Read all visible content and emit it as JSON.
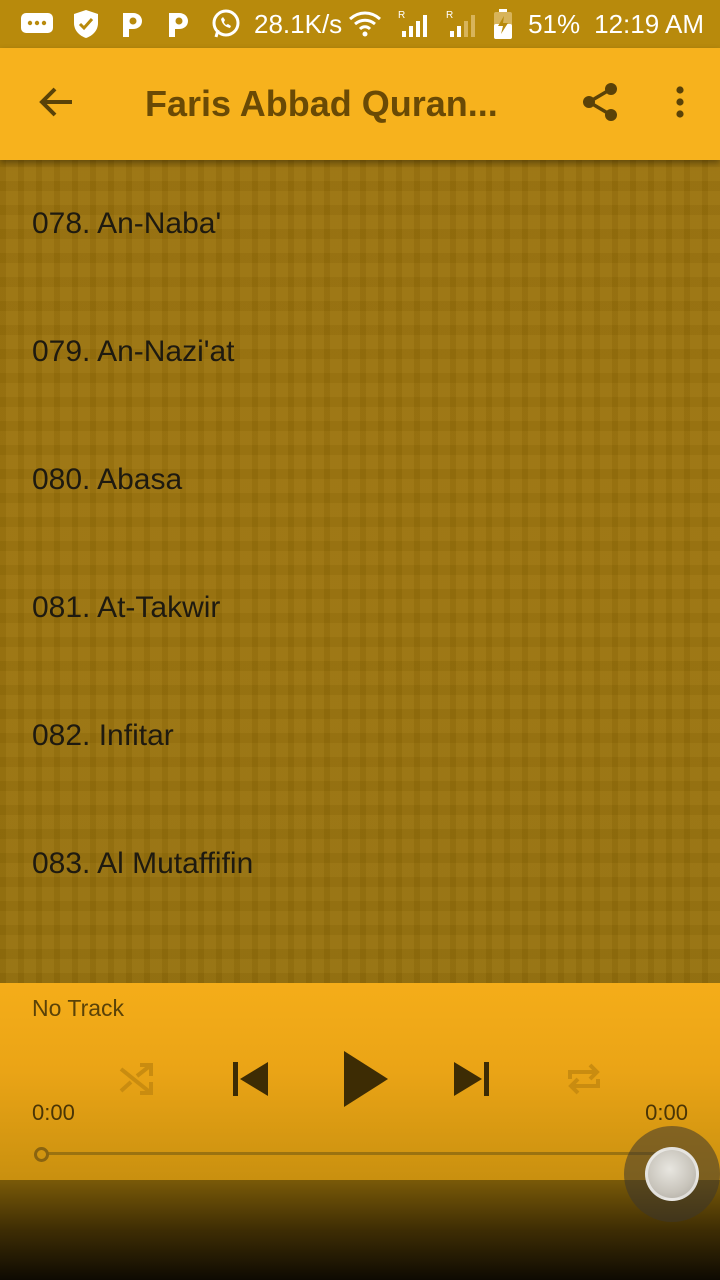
{
  "status_bar": {
    "network_speed": "28.1K/s",
    "battery": "51%",
    "time": "12:19 AM",
    "icons": [
      "messages-icon",
      "shield-icon",
      "parking-icon",
      "parking-icon",
      "whatsapp-icon",
      "wifi-icon",
      "signal-icon",
      "signal-icon",
      "battery-icon"
    ]
  },
  "app_bar": {
    "title": "Faris Abbad Quran...",
    "back_icon": "arrow-back-icon",
    "share_icon": "share-icon",
    "more_icon": "more-vert-icon"
  },
  "tracks": [
    {
      "label": "078. An-Naba'"
    },
    {
      "label": "079. An-Nazi'at"
    },
    {
      "label": "080. Abasa"
    },
    {
      "label": "081. At-Takwir"
    },
    {
      "label": "082. Infitar"
    },
    {
      "label": "083. Al Mutaffifin"
    }
  ],
  "player": {
    "now_playing": "No Track",
    "time_elapsed": "0:00",
    "time_total": "0:00",
    "progress": 0,
    "controls": [
      "shuffle-icon",
      "skip-previous-icon",
      "play-icon",
      "skip-next-icon",
      "repeat-icon"
    ]
  },
  "colors": {
    "status_bar": "#b88a0c",
    "app_bar": "#f7b21d",
    "title_text": "#6a4a05",
    "list_background": "#9a720d",
    "player_background": "#f5ad19"
  }
}
